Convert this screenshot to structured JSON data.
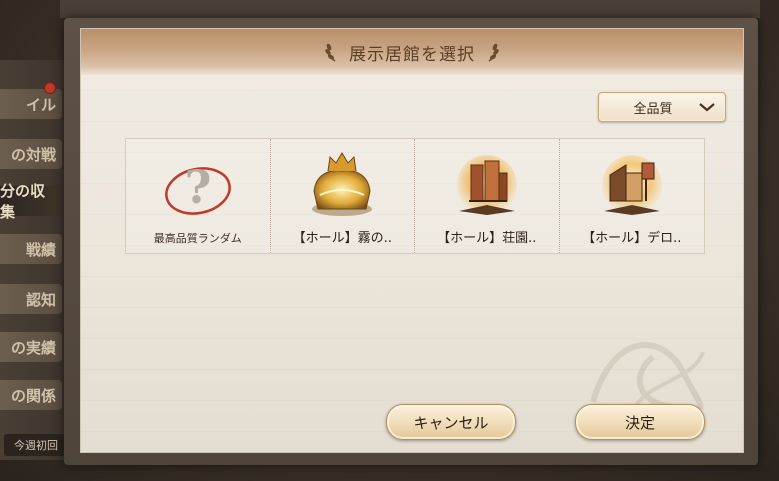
{
  "background": {
    "sidebar_items": [
      "イル",
      "の対戦",
      "分の収集",
      "戦績",
      "認知",
      "の実績",
      "の関係"
    ],
    "sidebar_bottom": "今週初回"
  },
  "modal": {
    "title": "展示居館を選択",
    "filter": {
      "selected": "全品質"
    },
    "items": [
      {
        "label": "最高品質ランダム",
        "icon": "random-question-icon"
      },
      {
        "label": "【ホール】霧の..",
        "icon": "fog-hall-icon"
      },
      {
        "label": "【ホール】荘園..",
        "icon": "manor-hall-icon"
      },
      {
        "label": "【ホール】デロ..",
        "icon": "dero-hall-icon"
      }
    ],
    "cancel_label": "キャンセル",
    "confirm_label": "決定"
  },
  "colors": {
    "title_text": "#5a3f27",
    "accent_red": "#c0392b",
    "button_border": "#b48d5a"
  }
}
